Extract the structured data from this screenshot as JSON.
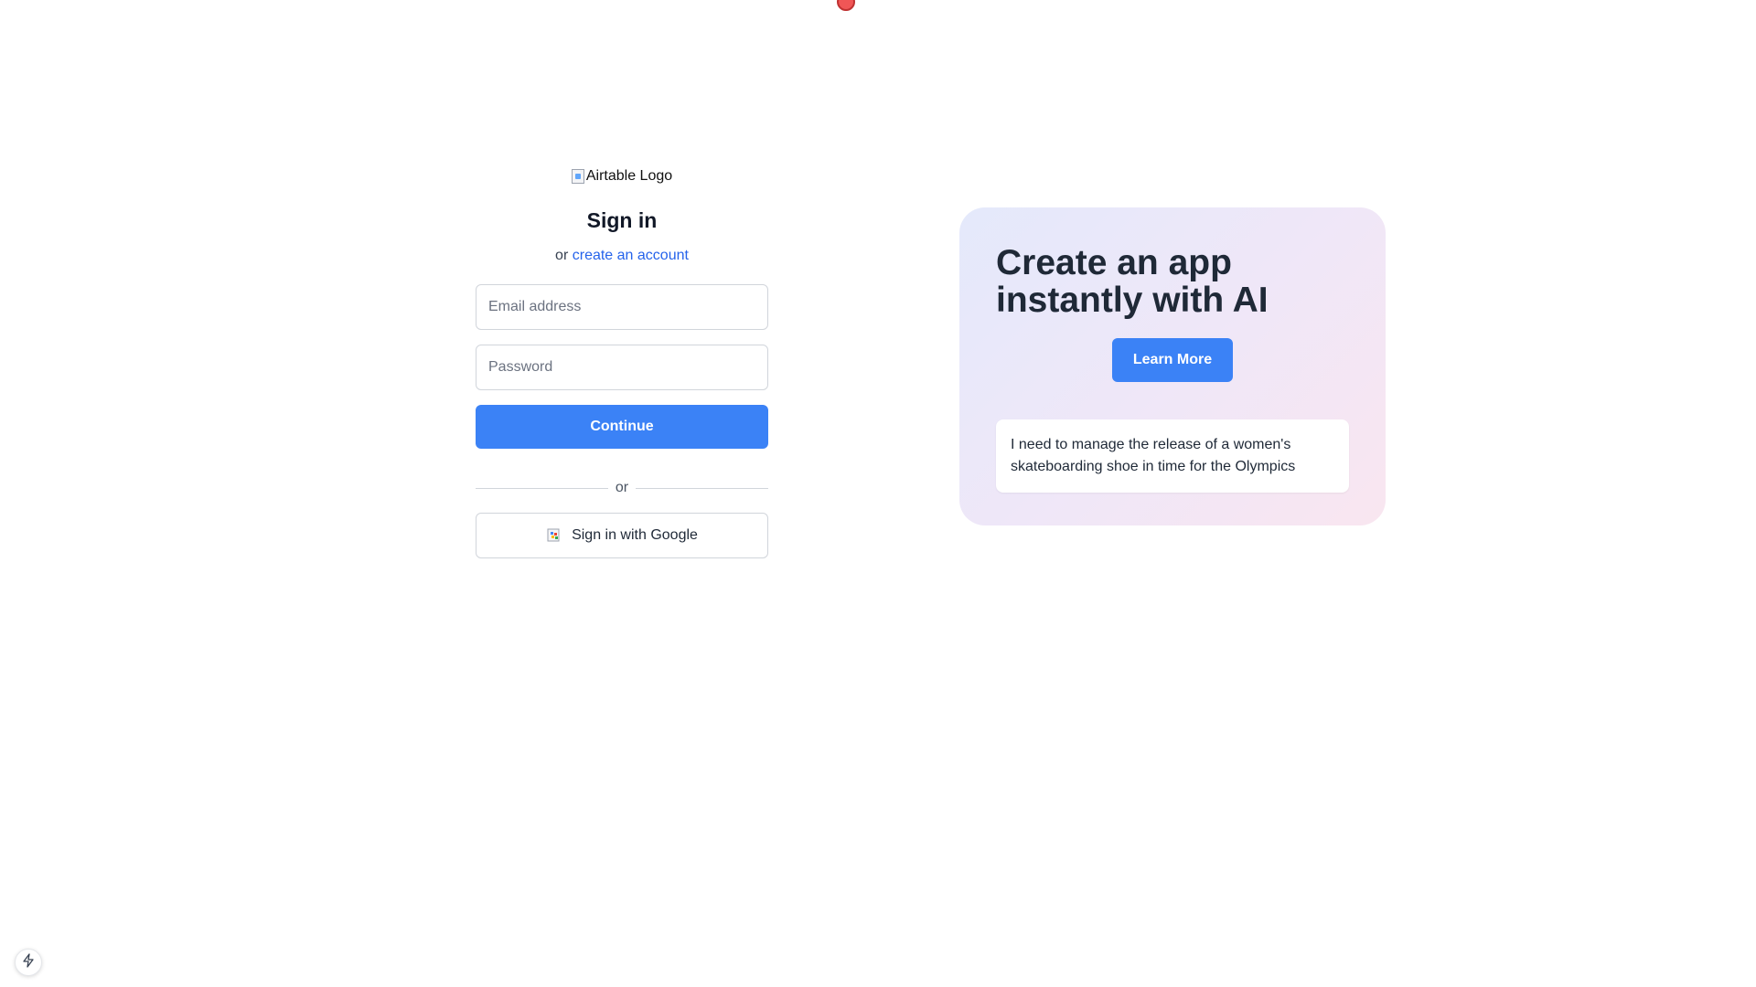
{
  "signin": {
    "logo_alt": "Airtable Logo",
    "title": "Sign in",
    "subtitle_prefix": "or",
    "create_account_link": "create an account",
    "email_placeholder": "Email address",
    "password_placeholder": "Password",
    "continue_label": "Continue",
    "divider_text": "or",
    "google_label": "Sign in with Google"
  },
  "promo": {
    "title_line1": "Create an app",
    "title_line2": "instantly with AI",
    "learn_more_label": "Learn More",
    "prompt_text": "I need to manage the release of a women's skateboarding shoe in time for the Olympics"
  },
  "icons": {
    "logo": "broken-image-icon",
    "google": "google-icon",
    "bolt": "bolt-icon"
  },
  "colors": {
    "accent": "#3b82f6",
    "link": "#2563eb",
    "cursor_marker": "#ef4444"
  }
}
